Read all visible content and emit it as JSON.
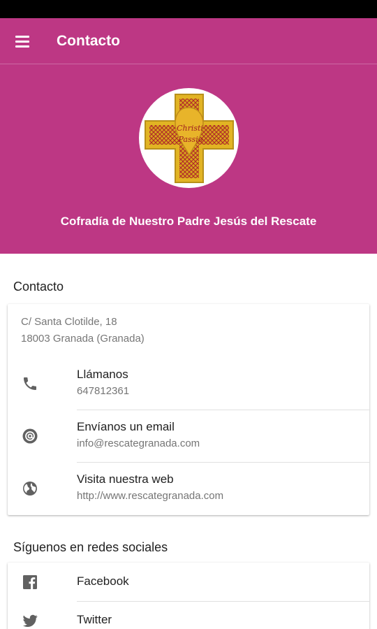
{
  "app_bar": {
    "title": "Contacto",
    "menu_icon": "hamburger-menu-icon",
    "color": "#bd3784"
  },
  "hero": {
    "logo_text_line1": "Christi",
    "logo_text_line2": "Passio",
    "org_name": "Cofradía de Nuestro Padre Jesús del Rescate"
  },
  "contact_section": {
    "title": "Contacto",
    "address_line1": "C/ Santa Clotilde, 18",
    "address_line2": "18003 Granada (Granada)",
    "items": [
      {
        "label": "Llámanos",
        "value": "647812361",
        "icon": "phone-icon"
      },
      {
        "label": "Envíanos un email",
        "value": "info@rescategranada.com",
        "icon": "at-sign-icon"
      },
      {
        "label": "Visita nuestra web",
        "value": "http://www.rescategranada.com",
        "icon": "globe-icon"
      }
    ]
  },
  "social_section": {
    "title": "Síguenos en redes sociales",
    "items": [
      {
        "label": "Facebook",
        "icon": "facebook-icon"
      },
      {
        "label": "Twitter",
        "icon": "twitter-icon"
      }
    ]
  }
}
